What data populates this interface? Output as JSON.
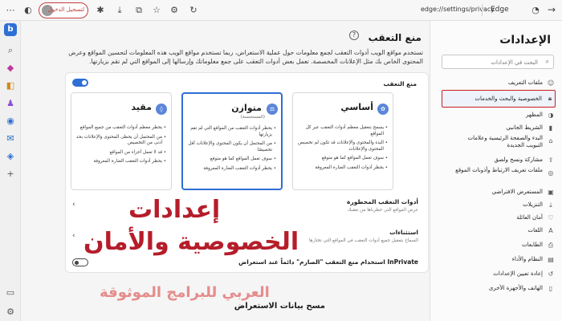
{
  "toolbar": {
    "signin_label": "لتسجيل الدخول",
    "address_url": "edge://settings/privacy",
    "browser_name": "Edge",
    "icons": [
      "more-icon",
      "favorites-icon",
      "collections-icon",
      "downloads-icon",
      "extensions-icon",
      "refresh-icon",
      "settings-icon",
      "copilot-icon"
    ]
  },
  "main": {
    "title": "منع التعقب",
    "description": "تستخدم مواقع الويب أدوات التعقب لجمع معلومات حول عملية الاستعراض، ربما تستخدم مواقع الويب هذه المعلومات لتحسين المواقع وعرض المحتوى الخاص بك مثل الإعلانات المخصصة. تعمل بعض أدوات التعقب على جمع معلوماتك وإرسالها إلى المواقع التي لم تقم بزيارتها.",
    "tracking_label": "منع التعقب",
    "options": [
      {
        "title": "أساسي",
        "subtitle": "",
        "bullets": [
          "يسمح بتعقيل معظم أدوات التعقب عبر كل المواقع",
          "البدء والمحتوى والإعلانات قد تكون لم تخصيص المحتوى والإعلانات",
          "سوف تعمل المواقع كما هو متوقع",
          "يحظر أدوات التعقب الضارة المعروفة"
        ]
      },
      {
        "title": "متوازن",
        "subtitle": "(المستحسنة)",
        "bullets": [
          "يحظر أدوات التعقب من المواقع التي لم تقم بزيارتها",
          "من المحتمل أن يكون المحتوى والإعلانات أقل تخصيصًا",
          "سوف تعمل المواقع كما هو متوقع",
          "يحظر أدوات التعقب الضارة المعروفة"
        ]
      },
      {
        "title": "مقيد",
        "subtitle": "",
        "bullets": [
          "يحظر معظم أدوات التعقب من جميع المواقع",
          "من المحتمل أن يحظى المحتوى والإعلانات بحد أدنى من التخصيص",
          "قد لا تعمل أجزاء من المواقع",
          "يحظر أدوات التعقب الضارة المعروفة"
        ]
      }
    ],
    "blocked_trackers_title": "أدوات التعقب المحظورة",
    "blocked_trackers_desc": "عرض المواقع التي حظرناها من تعقبك",
    "exceptions_title": "استثناءات",
    "exceptions_desc": "السماح بتعقيل جميع أدوات التعقب في المواقع التي تختارها",
    "inprivate_label": "استخدام منع التعقب \"الصارم\" دائماً عند استعراض InPrivate",
    "clear_data_title": "مسح بيانات الاستعراض"
  },
  "overlay": {
    "title_line1": "إعدادات",
    "title_line2": "الخصوصية والأمان",
    "watermark": "العربي للبرامج الموثوقة"
  },
  "settings": {
    "heading": "الإعدادات",
    "search_placeholder": "البحث في الإعدادات",
    "nav": [
      {
        "label": "ملفات التعريف",
        "icon": "person-icon"
      },
      {
        "label": "الخصوصية والبحث والخدمات",
        "icon": "lock-icon",
        "active": true
      },
      {
        "label": "المظهر",
        "icon": "palette-icon"
      },
      {
        "label": "الشريط الجانبي",
        "icon": "sidebar-icon"
      },
      {
        "label": "البدء والصفحة الرئيسية وعلامات التبويب الجديدة",
        "icon": "home-icon"
      },
      {
        "label": "مشاركة ونسخ ولصق",
        "icon": "share-icon"
      },
      {
        "label": "ملفات تعريف الارتباط وأذونات الموقع",
        "icon": "cookie-icon"
      },
      {
        "label": "المستعرض الافتراضي",
        "icon": "browser-icon"
      },
      {
        "label": "التنزيلات",
        "icon": "download-icon"
      },
      {
        "label": "أمان العائلة",
        "icon": "family-icon"
      },
      {
        "label": "اللغات",
        "icon": "language-icon"
      },
      {
        "label": "الطابعات",
        "icon": "printer-icon"
      },
      {
        "label": "النظام والأداء",
        "icon": "system-icon"
      },
      {
        "label": "إعادة تعيين الإعدادات",
        "icon": "reset-icon"
      },
      {
        "label": "الهاتف والأجهزة الأخرى",
        "icon": "phone-icon"
      }
    ]
  },
  "colors": {
    "accent": "#2f6ed4",
    "highlight_border": "#c81f1f",
    "overlay_red": "#b51d2a",
    "watermark_pink": "#e58c8c"
  }
}
